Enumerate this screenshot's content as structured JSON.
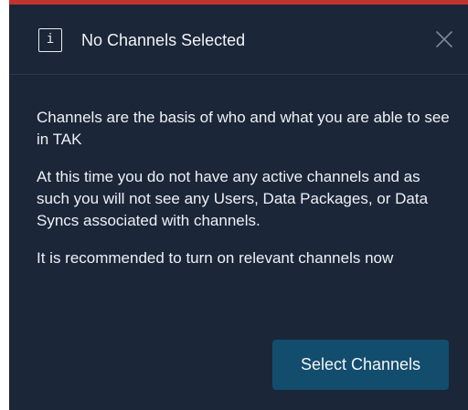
{
  "dialog": {
    "title": "No Channels Selected",
    "info_icon_glyph": "i",
    "close_icon": "close-icon",
    "paragraphs": [
      "Channels are the basis of who and what you are able to see in TAK",
      "At this time you do not have any active channels and as such you will not see any Users, Data Packages, or Data Syncs associated with channels.",
      "It is recommended to turn on relevant channels now"
    ],
    "primary_button": "Select Channels"
  },
  "colors": {
    "background": "#1b2638",
    "accent_bar": "#c0332f",
    "button": "#134d6d",
    "text": "#eef1f5"
  }
}
